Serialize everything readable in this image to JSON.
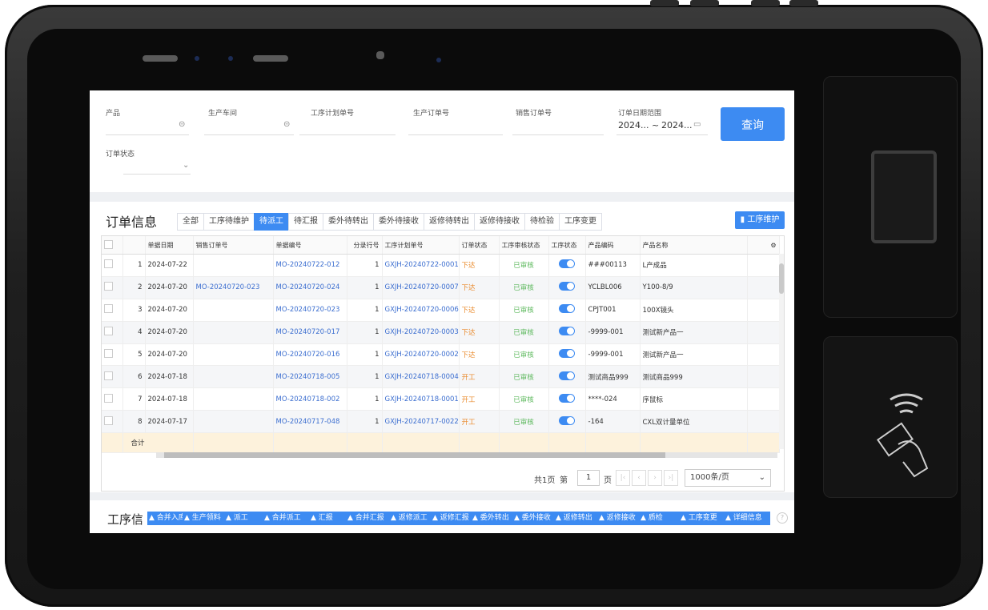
{
  "filters": {
    "product": {
      "label": "产品",
      "value": ""
    },
    "workshop": {
      "label": "生产车间",
      "value": ""
    },
    "process_plan_no": {
      "label": "工序计划单号",
      "value": ""
    },
    "production_order_no": {
      "label": "生产订单号",
      "value": ""
    },
    "sales_order_no": {
      "label": "销售订单号",
      "value": ""
    },
    "date_range": {
      "label": "订单日期范围",
      "start": "2024...",
      "separator": "~",
      "end": "2024..."
    },
    "order_status": {
      "label": "订单状态",
      "value": ""
    },
    "query_button": "查询"
  },
  "orders": {
    "title": "订单信息",
    "tabs": [
      {
        "label": "全部",
        "active": false
      },
      {
        "label": "工序待维护",
        "active": false
      },
      {
        "label": "待派工",
        "active": true
      },
      {
        "label": "待汇报",
        "active": false
      },
      {
        "label": "委外待转出",
        "active": false
      },
      {
        "label": "委外待接收",
        "active": false
      },
      {
        "label": "返修待转出",
        "active": false
      },
      {
        "label": "返修待接收",
        "active": false
      },
      {
        "label": "待检验",
        "active": false
      },
      {
        "label": "工序变更",
        "active": false
      }
    ],
    "maintain_button": "工序维护",
    "columns": [
      "",
      "",
      "单据日期",
      "销售订单号",
      "单据编号",
      "分录行号",
      "工序计划单号",
      "订单状态",
      "工序审核状态",
      "工序状态",
      "产品编码",
      "产品名称"
    ],
    "rows": [
      {
        "idx": "1",
        "date": "2024-07-22",
        "sales_no": "",
        "doc_no": "MO-20240722-012",
        "line": "1",
        "plan_no": "GXJH-20240722-0001",
        "status": "下达",
        "audit": "已审核",
        "code": "###00113",
        "name": "L产成品"
      },
      {
        "idx": "2",
        "date": "2024-07-20",
        "sales_no": "MO-20240720-023",
        "doc_no": "MO-20240720-024",
        "line": "1",
        "plan_no": "GXJH-20240720-0007",
        "status": "下达",
        "audit": "已审核",
        "code": "YCLBL006",
        "name": "Y100-8/9"
      },
      {
        "idx": "3",
        "date": "2024-07-20",
        "sales_no": "",
        "doc_no": "MO-20240720-023",
        "line": "1",
        "plan_no": "GXJH-20240720-0006",
        "status": "下达",
        "audit": "已审核",
        "code": "CPJT001",
        "name": "100X镜头"
      },
      {
        "idx": "4",
        "date": "2024-07-20",
        "sales_no": "",
        "doc_no": "MO-20240720-017",
        "line": "1",
        "plan_no": "GXJH-20240720-0003",
        "status": "下达",
        "audit": "已审核",
        "code": "-9999-001",
        "name": "测试新产品一"
      },
      {
        "idx": "5",
        "date": "2024-07-20",
        "sales_no": "",
        "doc_no": "MO-20240720-016",
        "line": "1",
        "plan_no": "GXJH-20240720-0002",
        "status": "下达",
        "audit": "已审核",
        "code": "-9999-001",
        "name": "测试新产品一"
      },
      {
        "idx": "6",
        "date": "2024-07-18",
        "sales_no": "",
        "doc_no": "MO-20240718-005",
        "line": "1",
        "plan_no": "GXJH-20240718-0004",
        "status": "开工",
        "audit": "已审核",
        "code": "测试商品999",
        "name": "测试商品999"
      },
      {
        "idx": "7",
        "date": "2024-07-18",
        "sales_no": "",
        "doc_no": "MO-20240718-002",
        "line": "1",
        "plan_no": "GXJH-20240718-0001",
        "status": "开工",
        "audit": "已审核",
        "code": "****-024",
        "name": "序鼠标"
      },
      {
        "idx": "8",
        "date": "2024-07-17",
        "sales_no": "",
        "doc_no": "MO-20240717-048",
        "line": "1",
        "plan_no": "GXJH-20240717-0022",
        "status": "开工",
        "audit": "已审核",
        "code": "-164",
        "name": "CXL双计量单位"
      }
    ],
    "summary_label": "合计",
    "pager": {
      "total": "共1页",
      "page_prefix": "第",
      "page": "1",
      "page_suffix": "页",
      "page_size": "1000条/页"
    }
  },
  "process": {
    "title": "工序信",
    "buttons": [
      "合并入库",
      "生产领料",
      "派工",
      "合并派工",
      "汇报",
      "合并汇报",
      "返修派工",
      "返修汇报",
      "委外转出",
      "委外接收",
      "返修转出",
      "返修接收",
      "质检",
      "工序变更",
      "详细信息"
    ]
  },
  "colors": {
    "accent": "#3d8bf2",
    "status_orange": "#e9892a",
    "audit_green": "#5cb85c",
    "summary_bg": "#fdf2dc"
  }
}
